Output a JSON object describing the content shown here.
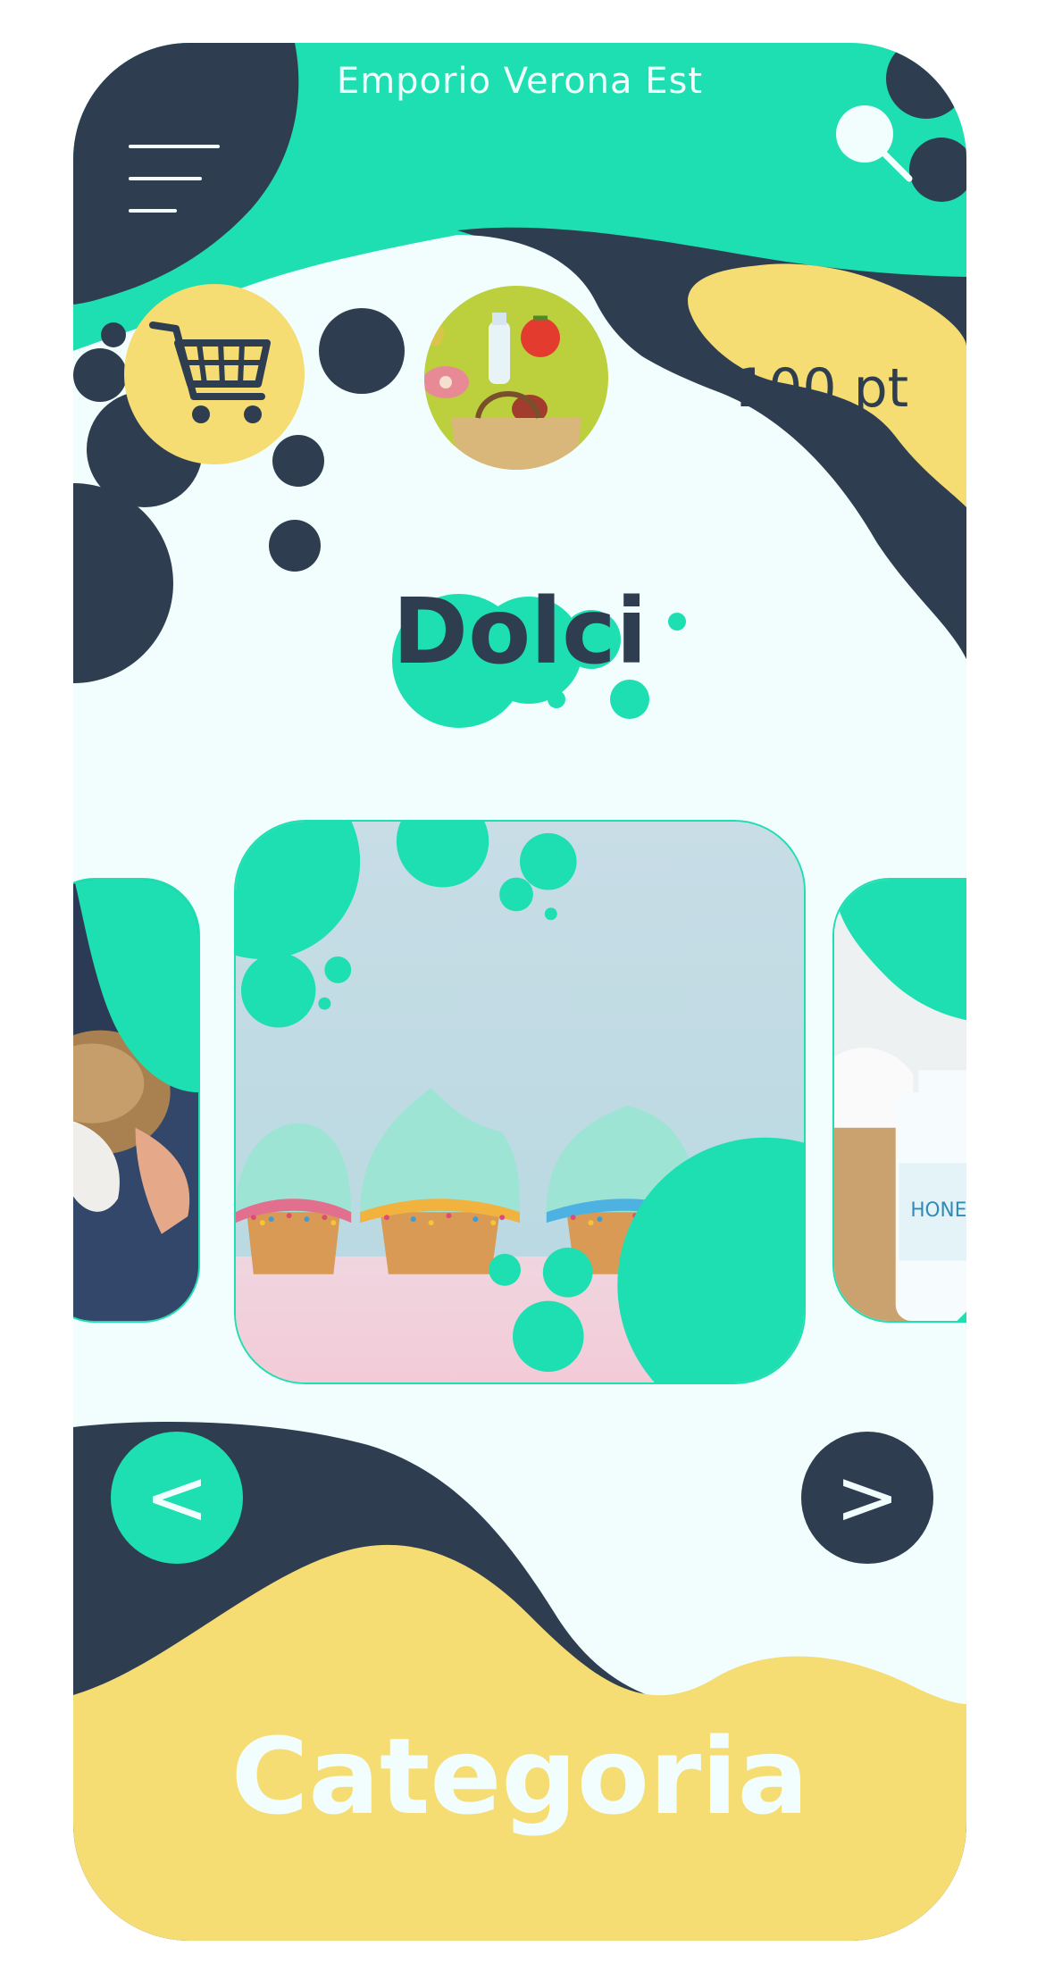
{
  "app": {
    "title": "Emporio Verona Est"
  },
  "header": {
    "menu_icon": "hamburger-menu-icon",
    "search_icon": "search-icon",
    "cart_icon": "shopping-cart-icon",
    "grocery_icon": "grocery-bag-icon",
    "points": "100 pt"
  },
  "main": {
    "category_title": "Dolci",
    "carousel": {
      "prev_label": "<",
      "next_label": ">",
      "cards": [
        {
          "image": "bread-in-hands-photo"
        },
        {
          "image": "cupcakes-with-sprinkles-photo"
        },
        {
          "image": "honest-cleaning-bottle-photo"
        }
      ]
    }
  },
  "footer": {
    "label": "Categoria"
  },
  "colors": {
    "teal": "#1ddfb1",
    "navy": "#2e3e50",
    "yellow": "#f5dc73",
    "background": "#f1fefd"
  }
}
